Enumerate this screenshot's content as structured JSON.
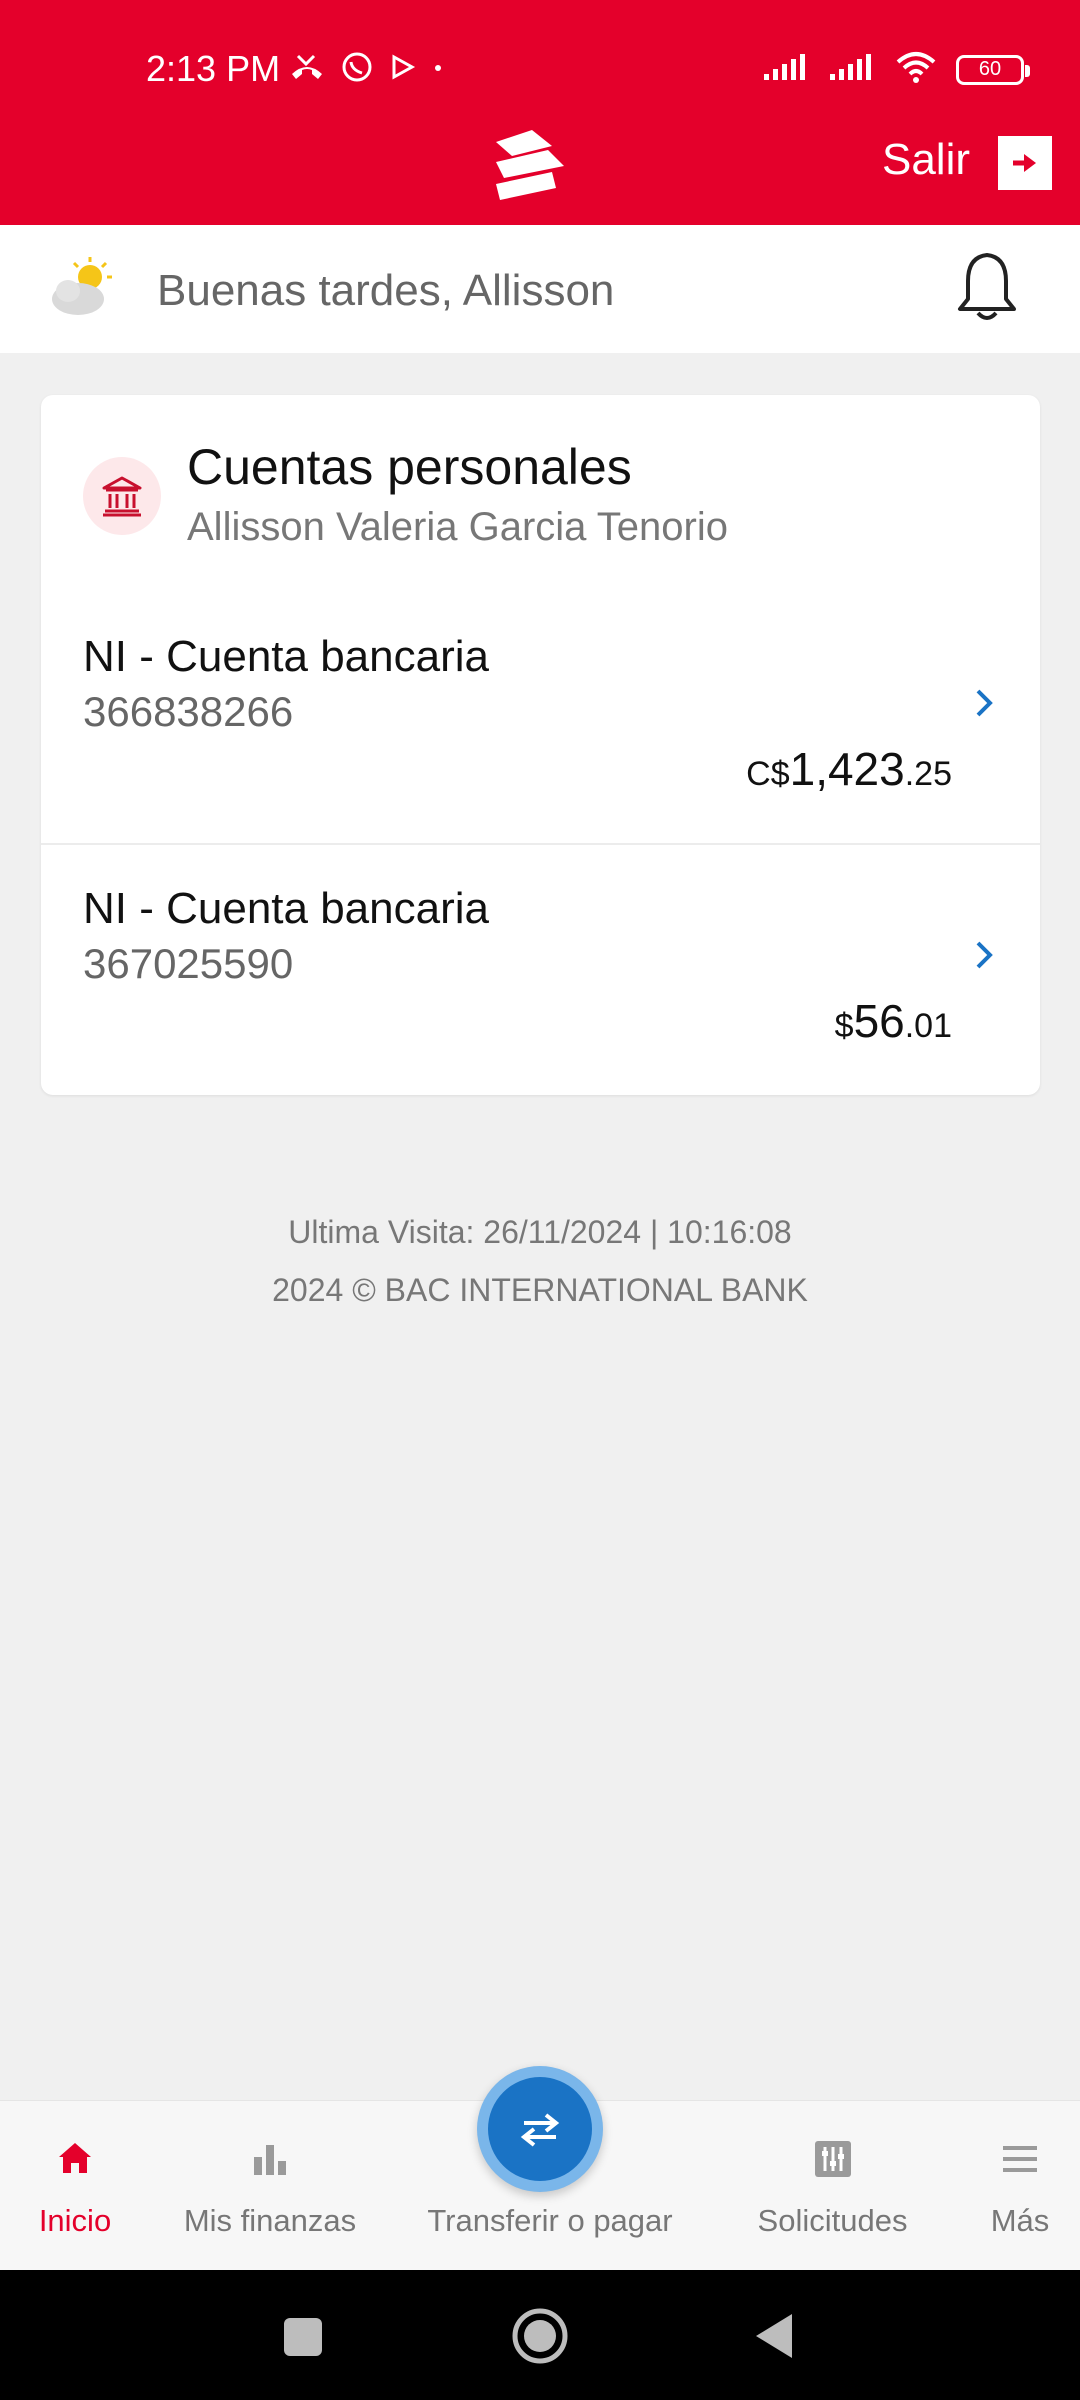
{
  "status_bar": {
    "time": "2:13 PM",
    "battery": "60",
    "left_icons": [
      "missed-call-icon",
      "whatsapp-icon",
      "play-store-icon",
      "dot-icon"
    ],
    "right_icons": [
      "signal-icon",
      "signal-icon",
      "wifi-icon",
      "battery-icon"
    ]
  },
  "header": {
    "logout_label": "Salir",
    "brand_color": "#e4002b"
  },
  "greeting": {
    "text": "Buenas tardes, Allisson"
  },
  "accounts_card": {
    "title": "Cuentas personales",
    "owner": "Allisson Valeria Garcia Tenorio",
    "accounts": [
      {
        "name": "NI - Cuenta bancaria",
        "number": "366838266",
        "currency": "C$",
        "balance_int": "1,423",
        "balance_dec": ".25"
      },
      {
        "name": "NI - Cuenta bancaria",
        "number": "367025590",
        "currency": "$",
        "balance_int": "56",
        "balance_dec": ".01"
      }
    ]
  },
  "footer": {
    "last_visit": "Ultima Visita: 26/11/2024 | 10:16:08",
    "copyright": "2024 © BAC INTERNATIONAL BANK"
  },
  "bottom_nav": {
    "items": [
      {
        "label": "Inicio",
        "icon": "home-icon",
        "active": true
      },
      {
        "label": "Mis finanzas",
        "icon": "bar-chart-icon",
        "active": false
      },
      {
        "label": "Transferir o pagar",
        "icon": "transfer-icon",
        "active": false
      },
      {
        "label": "Solicitudes",
        "icon": "sliders-icon",
        "active": false
      },
      {
        "label": "Más",
        "icon": "menu-icon",
        "active": false
      }
    ],
    "accent_color": "#1a73c5"
  }
}
